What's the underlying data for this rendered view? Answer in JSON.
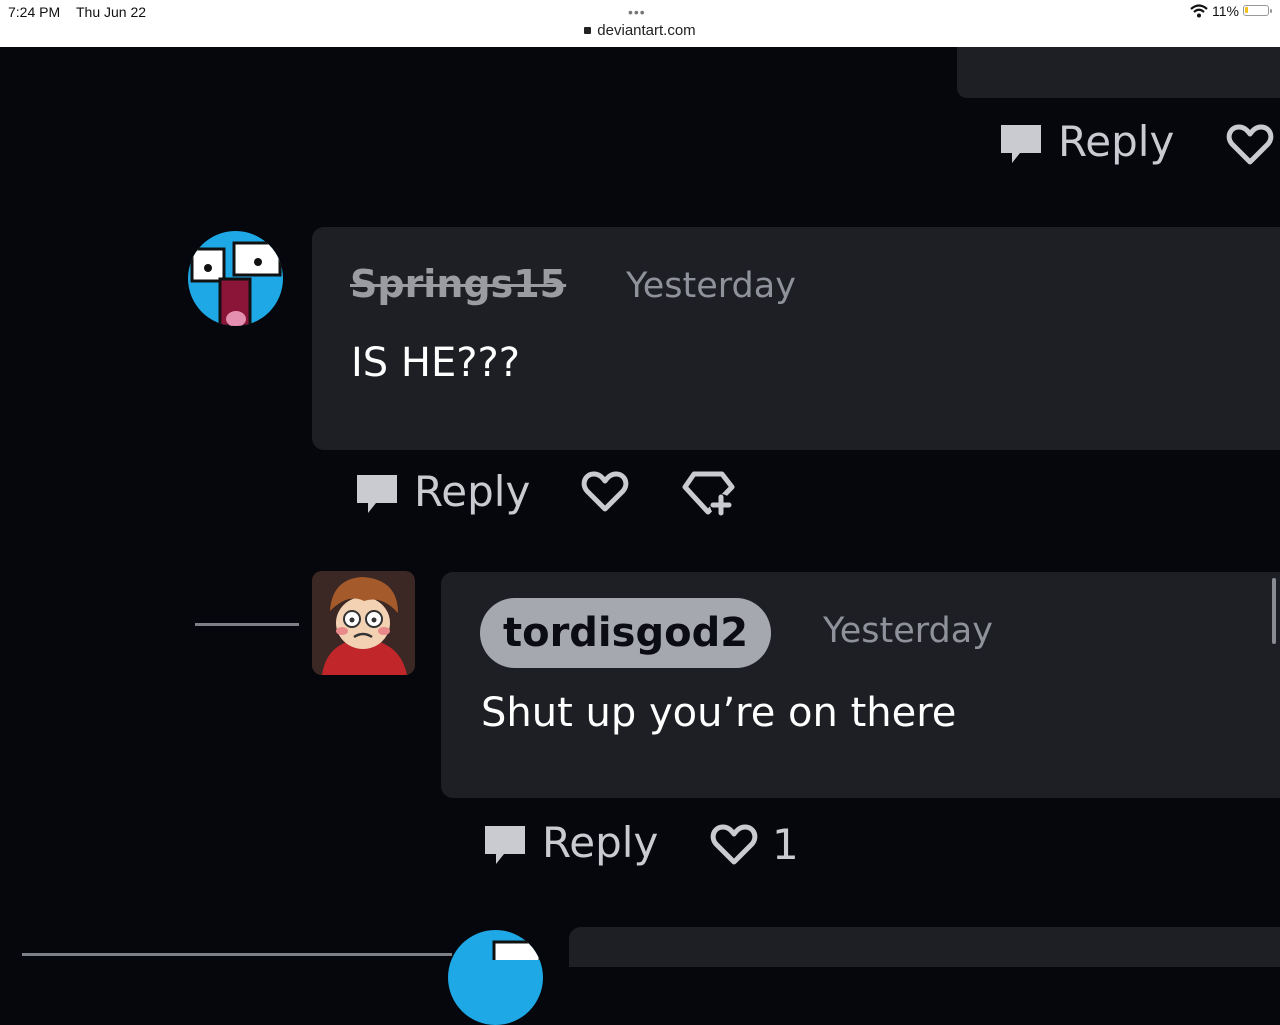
{
  "status_bar": {
    "time": "7:24 PM",
    "date": "Thu Jun 22",
    "dots": "•••",
    "url": "deviantart.com",
    "battery": "11%"
  },
  "top_comment": {
    "reply_label": "Reply"
  },
  "comment1": {
    "username": "Springs15",
    "time": "Yesterday",
    "text": "IS HE???",
    "reply_label": "Reply"
  },
  "comment2": {
    "username": "tordisgod2",
    "time": "Yesterday",
    "text": "Shut up you’re on there",
    "reply_label": "Reply",
    "like_count": "1"
  },
  "colors": {
    "background": "#06070d",
    "bubble": "#1d1f24",
    "pill": "#a6a8af",
    "muted_text": "#8f929a"
  }
}
